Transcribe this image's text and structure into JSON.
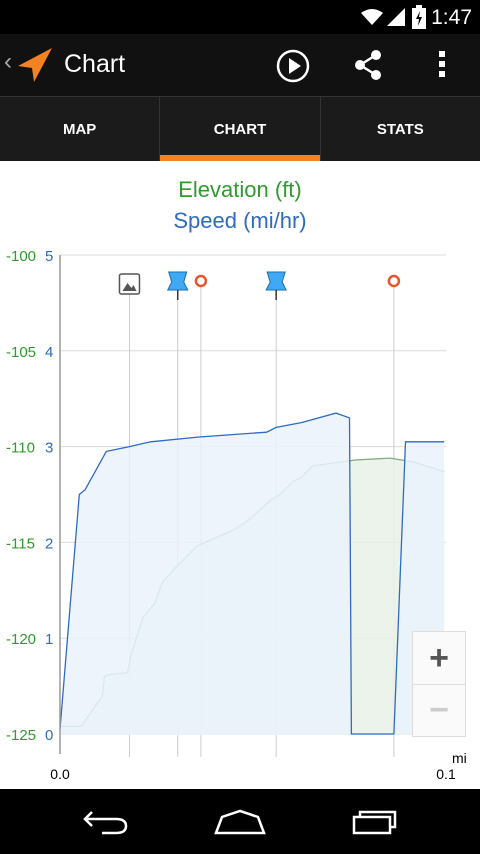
{
  "status_bar": {
    "time": "1:47"
  },
  "action_bar": {
    "title": "Chart"
  },
  "tabs": [
    {
      "label": "MAP",
      "active": false
    },
    {
      "label": "CHART",
      "active": true
    },
    {
      "label": "STATS",
      "active": false
    }
  ],
  "zoom": {
    "in_label": "+",
    "out_label": "−"
  },
  "icons": {
    "play": "play-icon",
    "share": "share-icon",
    "overflow": "overflow-menu-icon",
    "back": "back-icon",
    "home": "home-icon",
    "recent": "recent-apps-icon"
  },
  "colors": {
    "accent": "#f58220",
    "elevation": "#2e9c2e",
    "speed": "#2f6bc0",
    "elevation_fill": "#e9f1e6",
    "speed_fill": "#eaf2fb"
  },
  "chart_data": {
    "type": "area",
    "title_elevation": "Elevation (ft)",
    "title_speed": "Speed (mi/hr)",
    "xlabel": "mi",
    "x_ticks": [
      "0.0",
      "0.1"
    ],
    "xlim": [
      0,
      0.1
    ],
    "elevation_axis": {
      "ticks": [
        "-100",
        "-105",
        "-110",
        "-115",
        "-120",
        "-125"
      ],
      "ylim": [
        -125,
        -100
      ]
    },
    "speed_axis": {
      "ticks": [
        "5",
        "4",
        "3",
        "2",
        "1",
        "0"
      ],
      "ylim": [
        0,
        5
      ]
    },
    "series": [
      {
        "name": "Elevation (ft)",
        "x": [
          0,
          0.0055,
          0.011,
          0.0115,
          0.0126,
          0.0175,
          0.0185,
          0.0215,
          0.0245,
          0.0265,
          0.03,
          0.0355,
          0.0375,
          0.0445,
          0.0485,
          0.0545,
          0.057,
          0.0605,
          0.0625,
          0.0655,
          0.0765,
          0.0855,
          0.0915,
          0.0995
        ],
        "y": [
          -124.6,
          -124.6,
          -123.0,
          -122.0,
          -121.9,
          -121.8,
          -120.8,
          -118.9,
          -118.2,
          -117.1,
          -116.3,
          -115.2,
          -115.0,
          -114.4,
          -113.9,
          -112.8,
          -112.5,
          -111.8,
          -111.6,
          -111.0,
          -110.7,
          -110.6,
          -110.8,
          -111.3
        ]
      },
      {
        "name": "Speed (mi/hr)",
        "x": [
          0,
          0.005,
          0.0065,
          0.012,
          0.018,
          0.0235,
          0.036,
          0.0535,
          0.056,
          0.0625,
          0.0715,
          0.075,
          0.0755,
          0.0865,
          0.0895,
          0.0995
        ],
        "y": [
          0.05,
          2.5,
          2.55,
          2.95,
          3.0,
          3.05,
          3.1,
          3.15,
          3.2,
          3.25,
          3.35,
          3.3,
          0.0,
          0.0,
          3.05,
          3.05
        ]
      }
    ],
    "markers": [
      {
        "type": "photo",
        "x": 0.018
      },
      {
        "type": "pin",
        "x": 0.0305
      },
      {
        "type": "waypoint",
        "x": 0.0365
      },
      {
        "type": "pin",
        "x": 0.056
      },
      {
        "type": "waypoint",
        "x": 0.0865
      }
    ]
  }
}
